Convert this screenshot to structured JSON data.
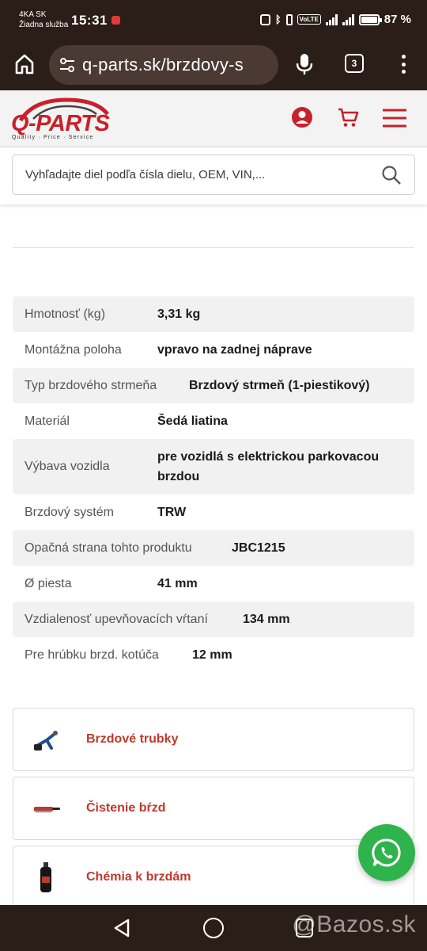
{
  "status_bar": {
    "carrier": "4KA SK",
    "service": "Žiadna služba",
    "time": "15:31",
    "network_badge": "VoLTE",
    "network_type": "4G",
    "battery": "87 %"
  },
  "browser": {
    "url": "q-parts.sk/brzdovy-s",
    "tab_count": "3"
  },
  "header": {
    "logo_text": "Q-PARTS",
    "logo_tagline": "Quality · Price · Service",
    "brand_color": "#c8212a"
  },
  "search": {
    "placeholder": "Vyhľadajte diel podľa čísla dielu, OEM, VIN,..."
  },
  "specs": [
    {
      "key": "Hmotnosť (kg)",
      "value": "3,31 kg"
    },
    {
      "key": "Montážna poloha",
      "value": "vpravo na zadnej náprave"
    },
    {
      "key": "Typ brzdového strmeňa",
      "value": "Brzdový strmeň (1-piestikový)"
    },
    {
      "key": "Materiál",
      "value": "Šedá liatina"
    },
    {
      "key": "Výbava vozidla",
      "value": "pre vozidlá s elektrickou parkovacou brzdou"
    },
    {
      "key": "Brzdový systém",
      "value": "TRW"
    },
    {
      "key": "Opačná strana tohto produktu",
      "value": "JBC1215"
    },
    {
      "key": "Ø piesta",
      "value": "41 mm"
    },
    {
      "key": "Vzdialenosť upevňovacích vŕtaní",
      "value": "134 mm"
    },
    {
      "key": "Pre hrúbku brzd. kotúča",
      "value": "12 mm"
    }
  ],
  "categories": [
    {
      "label": "Brzdové trubky",
      "icon": "brake-pipe-tool-icon"
    },
    {
      "label": "Čistenie bŕzd",
      "icon": "brush-icon"
    },
    {
      "label": "Chémia k brzdám",
      "icon": "spray-can-icon"
    }
  ],
  "watermark": "@Bazos.sk"
}
